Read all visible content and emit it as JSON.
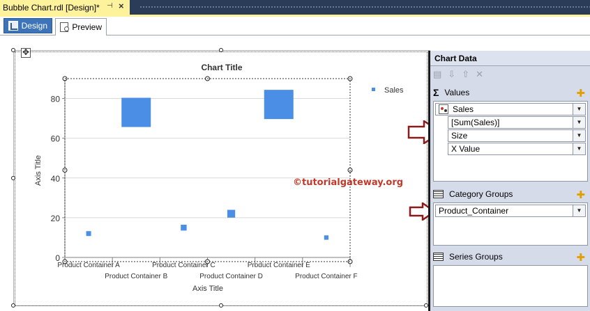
{
  "document_tab": {
    "title": "Bubble Chart.rdl [Design]*",
    "pin_icon": "pin-icon",
    "close_icon": "close-icon"
  },
  "view_tabs": [
    {
      "label": "Design",
      "icon": "design-icon",
      "active": true
    },
    {
      "label": "Preview",
      "icon": "preview-icon",
      "active": false
    }
  ],
  "watermark": "©tutorialgateway.org",
  "chart_data": {
    "type": "scatter",
    "title": "Chart Title",
    "xlabel": "Axis Title",
    "ylabel": "Axis Title",
    "categories": [
      "Product Container A",
      "Product Container B",
      "Product Container C",
      "Product Container D",
      "Product Container E",
      "Product Container F"
    ],
    "series": [
      {
        "name": "Sales",
        "values": [
          12,
          73,
          15,
          22,
          77,
          10
        ],
        "size": [
          1,
          6,
          1.2,
          1.6,
          6,
          0.9
        ]
      }
    ],
    "ylim": [
      0,
      90
    ],
    "yticks": [
      0,
      20,
      40,
      60,
      80
    ],
    "grid": true,
    "legend": "top-right",
    "colors": {
      "series": "#4a8ee6",
      "grid": "#d9d9d9",
      "axis": "#808080"
    }
  },
  "chart_data_pane": {
    "title": "Chart Data",
    "toolbar_icons": [
      "properties-icon",
      "move-down-icon",
      "move-up-icon",
      "delete-icon"
    ],
    "values": {
      "label": "Values",
      "series_field": "Sales",
      "fields": [
        "[Sum(Sales)]",
        "Size",
        "X Value"
      ]
    },
    "category_groups": {
      "label": "Category Groups",
      "field": "Product_Container"
    },
    "series_groups": {
      "label": "Series Groups"
    }
  },
  "colors": {
    "doc_tab": "#fff29d",
    "strip": "#2b3c59",
    "design_tab": "#3d73b9",
    "pane": "#d6dbe9",
    "arrow": "#8b1a1a",
    "watermark": "#c0392b"
  }
}
